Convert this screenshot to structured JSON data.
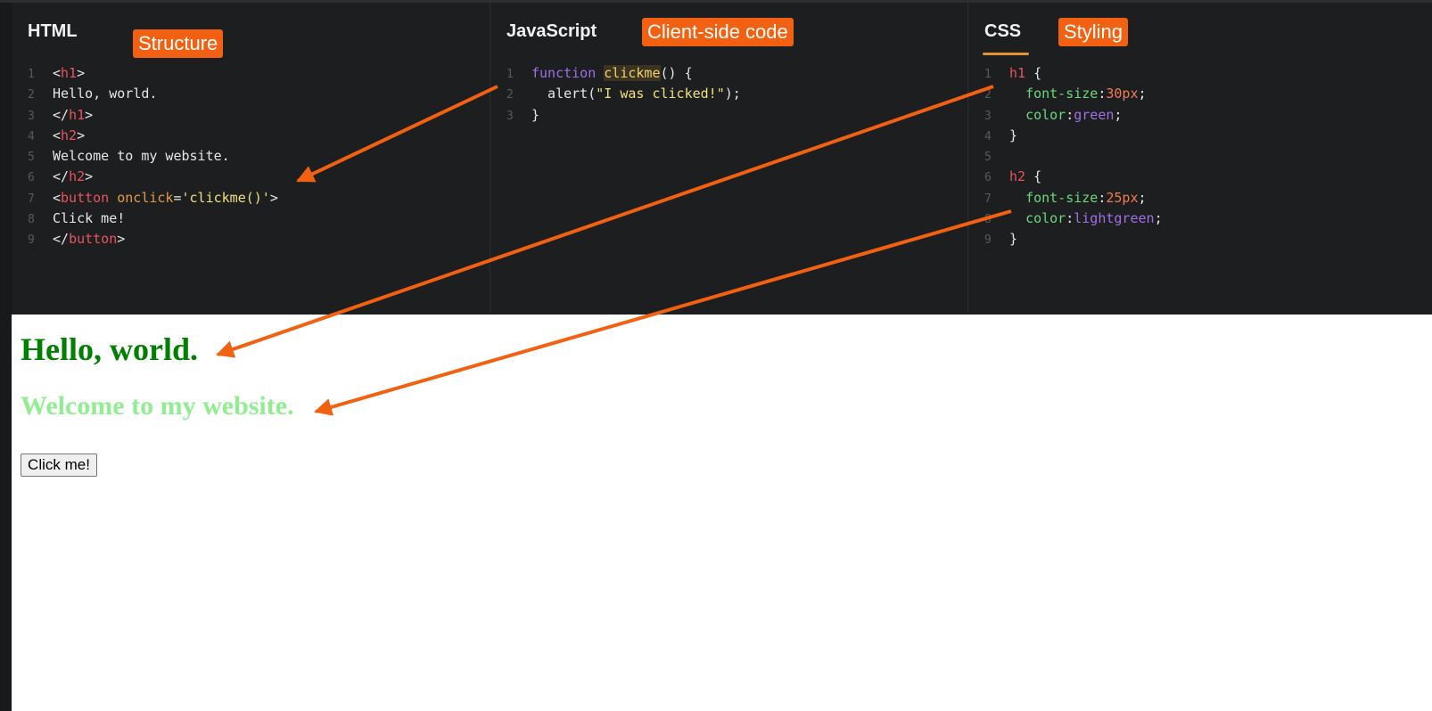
{
  "tabs": {
    "html": "HTML",
    "js": "JavaScript",
    "css": "CSS"
  },
  "labels": {
    "structure": "Structure",
    "client": "Client-side code",
    "styling": "Styling"
  },
  "html_code": {
    "lines": [
      {
        "n": "1",
        "a": "<",
        "b": "h1",
        "c": ">"
      },
      {
        "n": "2",
        "text": "Hello, world."
      },
      {
        "n": "3",
        "a": "</",
        "b": "h1",
        "c": ">"
      },
      {
        "n": "4",
        "a": "<",
        "b": "h2",
        "c": ">"
      },
      {
        "n": "5",
        "text": "Welcome to my website."
      },
      {
        "n": "6",
        "a": "</",
        "b": "h2",
        "c": ">"
      },
      {
        "n": "7",
        "a": "<",
        "b": "button",
        "attr": " onclick",
        "eq": "=",
        "str": "'clickme()'",
        "c": ">"
      },
      {
        "n": "8",
        "text": "Click me!"
      },
      {
        "n": "9",
        "a": "</",
        "b": "button",
        "c": ">"
      }
    ]
  },
  "js_code": {
    "line1": {
      "n": "1",
      "kw": "function",
      "sp": " ",
      "fn": "clickme",
      "rest": "() {"
    },
    "line2": {
      "n": "2",
      "pre": "  alert(",
      "str": "\"I was clicked!\"",
      "post": ");"
    },
    "line3": {
      "n": "3",
      "text": "}"
    }
  },
  "css_code": {
    "l1": {
      "n": "1",
      "sel": "h1",
      "rest": " {"
    },
    "l2": {
      "n": "2",
      "prop": "font-size",
      "colon": ":",
      "num": "30px",
      "semi": ";"
    },
    "l3": {
      "n": "3",
      "prop": "color",
      "colon": ":",
      "val": "green",
      "semi": ";"
    },
    "l4": {
      "n": "4",
      "text": "}"
    },
    "l5": {
      "n": "5",
      "text": ""
    },
    "l6": {
      "n": "6",
      "sel": "h2",
      "rest": " {"
    },
    "l7": {
      "n": "7",
      "prop": "font-size",
      "colon": ":",
      "num": "25px",
      "semi": ";"
    },
    "l8": {
      "n": "8",
      "prop": "color",
      "colon": ":",
      "val": "lightgreen",
      "semi": ";"
    },
    "l9": {
      "n": "9",
      "text": "}"
    }
  },
  "preview": {
    "h1": "Hello, world.",
    "h2": "Welcome to my website.",
    "button": "Click me!"
  },
  "colors": {
    "accent": "#f26111",
    "h1": "green",
    "h2": "lightgreen"
  }
}
